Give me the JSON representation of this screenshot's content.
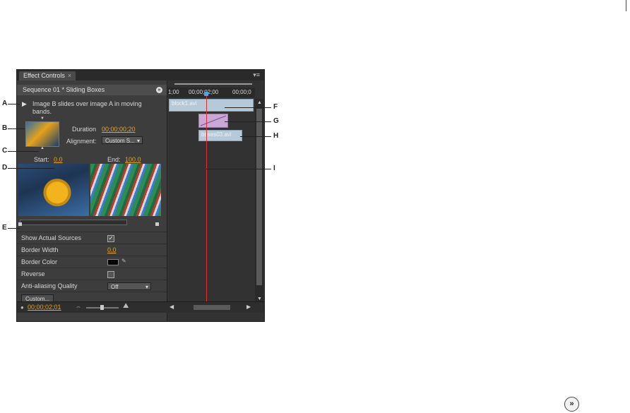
{
  "panel": {
    "tab_title": "Effect Controls",
    "sequence_title": "Sequence 01 * Sliding Boxes",
    "description": "Image B slides over image A in moving bands.",
    "duration_label": "Duration",
    "duration_value": "00;00;00;20",
    "alignment_label": "Alignment:",
    "alignment_value": "Custom S...",
    "start_label": "Start:",
    "start_value": "0.0",
    "end_label": "End:",
    "end_value": "100.0",
    "properties": {
      "show_actual_sources": "Show Actual Sources",
      "border_width": "Border Width",
      "border_width_value": "0.0",
      "border_color": "Border Color",
      "reverse": "Reverse",
      "antialiasing": "Anti-aliasing Quality",
      "antialiasing_value": "Off"
    },
    "custom_button": "Custom...",
    "current_time": "00;00;02;01"
  },
  "timeline": {
    "ruler": [
      "1;00",
      "00;00;02;00",
      "00;00;0"
    ],
    "clip_a": "block1.avi",
    "clip_b": "boxes03.avi"
  },
  "callouts": [
    "A",
    "B",
    "C",
    "D",
    "E",
    "F",
    "G",
    "H",
    "I"
  ],
  "colors": {
    "accent": "#e8a41a",
    "playhead": "#e03030"
  }
}
